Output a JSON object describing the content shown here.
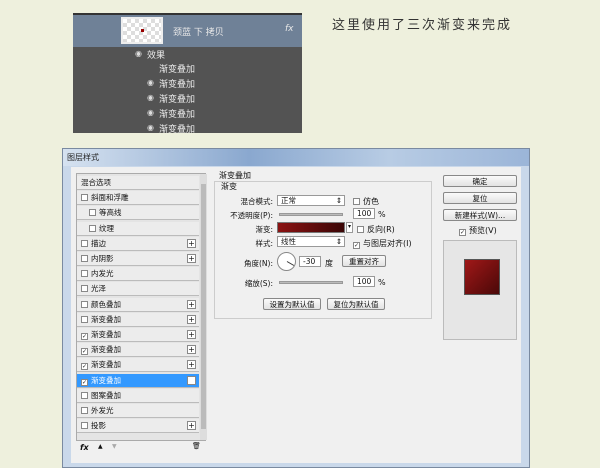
{
  "layers_panel": {
    "layer_name": "颈蓝 下 拷贝",
    "fx_label": "fx",
    "effects_label": "效果",
    "effects": [
      "渐变叠加",
      "渐变叠加",
      "渐变叠加",
      "渐变叠加",
      "渐变叠加"
    ]
  },
  "caption": "这里使用了三次渐变来完成",
  "dialog": {
    "title": "图层样式",
    "styles": [
      {
        "label": "混合选项",
        "checkbox": false,
        "checked": false,
        "plus": false
      },
      {
        "label": "斜面和浮雕",
        "checkbox": true,
        "checked": false,
        "plus": false
      },
      {
        "label": "等高线",
        "checkbox": true,
        "checked": false,
        "plus": false,
        "indent": true
      },
      {
        "label": "纹理",
        "checkbox": true,
        "checked": false,
        "plus": false,
        "indent": true
      },
      {
        "label": "描边",
        "checkbox": true,
        "checked": false,
        "plus": true
      },
      {
        "label": "内阴影",
        "checkbox": true,
        "checked": false,
        "plus": true
      },
      {
        "label": "内发光",
        "checkbox": true,
        "checked": false,
        "plus": false
      },
      {
        "label": "光泽",
        "checkbox": true,
        "checked": false,
        "plus": false
      },
      {
        "label": "颜色叠加",
        "checkbox": true,
        "checked": false,
        "plus": true
      },
      {
        "label": "渐变叠加",
        "checkbox": true,
        "checked": false,
        "plus": true
      },
      {
        "label": "渐变叠加",
        "checkbox": true,
        "checked": true,
        "plus": true
      },
      {
        "label": "渐变叠加",
        "checkbox": true,
        "checked": true,
        "plus": true
      },
      {
        "label": "渐变叠加",
        "checkbox": true,
        "checked": true,
        "plus": true
      },
      {
        "label": "渐变叠加",
        "checkbox": true,
        "checked": true,
        "plus": true,
        "selected": true
      },
      {
        "label": "图案叠加",
        "checkbox": true,
        "checked": false,
        "plus": false
      },
      {
        "label": "外发光",
        "checkbox": true,
        "checked": false,
        "plus": false
      },
      {
        "label": "投影",
        "checkbox": true,
        "checked": false,
        "plus": true
      }
    ],
    "footer": {
      "fx": "fx",
      "up": "▲",
      "down": "▼",
      "trash": "🗑"
    },
    "section_title": "渐变叠加",
    "group_title": "渐变",
    "blend_mode_label": "混合模式:",
    "blend_mode_value": "正常",
    "dither_label": "仿色",
    "opacity_label": "不透明度(P):",
    "opacity_value": "100",
    "percent": "%",
    "gradient_label": "渐变:",
    "reverse_label": "反向(R)",
    "style_label": "样式:",
    "style_value": "线性",
    "align_label": "与图层对齐(I)",
    "align_checked": true,
    "angle_label": "角度(N):",
    "angle_value": "-30",
    "degree": "度",
    "reset_align": "重置对齐",
    "scale_label": "缩放(S):",
    "scale_value": "100",
    "set_default": "设置为默认值",
    "reset_default": "复位为默认值",
    "ok": "确定",
    "reset": "复位",
    "new_style": "新建样式(W)...",
    "preview_label": "预览(V)",
    "preview_checked": true,
    "gradient_colors": [
      "#8b1212",
      "#3a0606"
    ]
  }
}
